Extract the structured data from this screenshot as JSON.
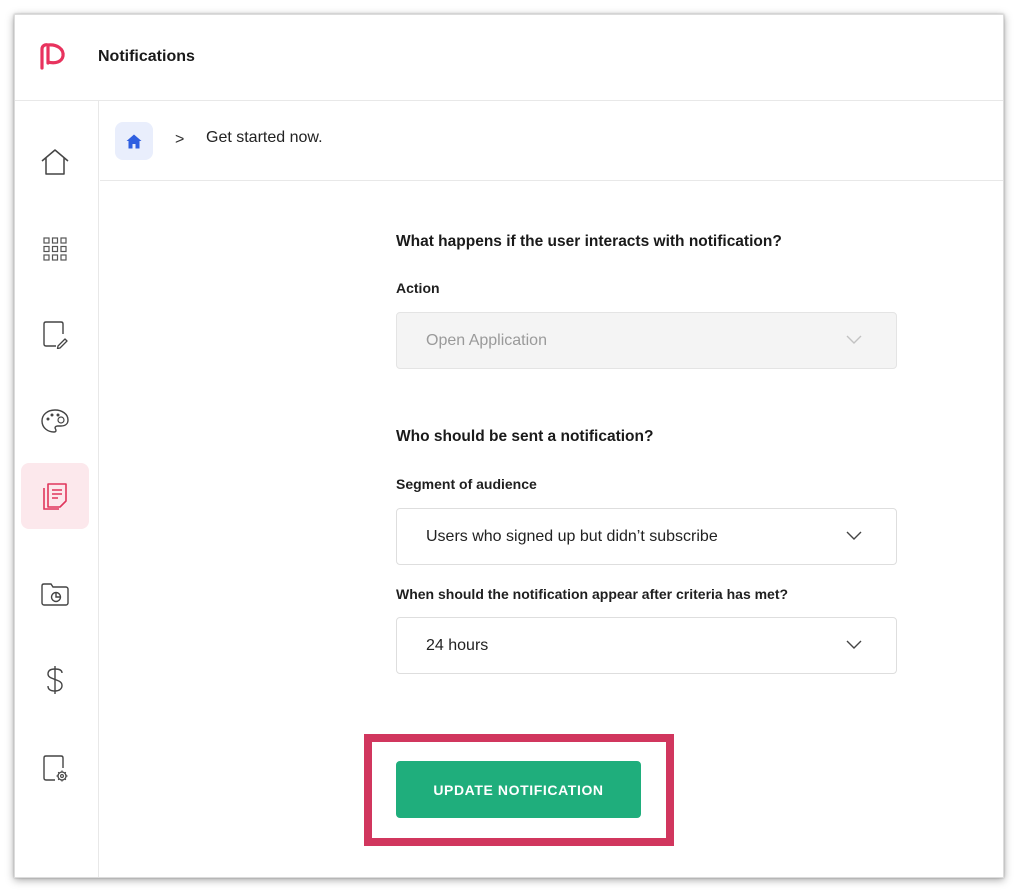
{
  "app": {
    "title": "Notifications",
    "brand_color": "#e8335e"
  },
  "sidebar": {
    "items": [
      {
        "icon": "home-icon",
        "active": false
      },
      {
        "icon": "grid-icon",
        "active": false
      },
      {
        "icon": "edit-document-icon",
        "active": false
      },
      {
        "icon": "palette-icon",
        "active": false
      },
      {
        "icon": "notes-icon",
        "active": true
      },
      {
        "icon": "folder-chart-icon",
        "active": false
      },
      {
        "icon": "dollar-icon",
        "active": false
      },
      {
        "icon": "document-settings-icon",
        "active": false
      }
    ],
    "active_bg": "#fce8ec"
  },
  "breadcrumb": {
    "separator": ">",
    "current": "Get started now."
  },
  "form": {
    "interaction_heading": "What happens if the user interacts with notification?",
    "action_label": "Action",
    "action_value": "Open Application",
    "audience_heading": "Who should be sent a notification?",
    "segment_label": "Segment of audience",
    "segment_value": "Users who signed up but didn’t subscribe",
    "timing_label": "When should the notification appear after criteria has met?",
    "timing_value": "24 hours"
  },
  "actions": {
    "update_label": "UPDATE NOTIFICATION",
    "update_color": "#1fae7c",
    "highlight_color": "#d1365e"
  }
}
